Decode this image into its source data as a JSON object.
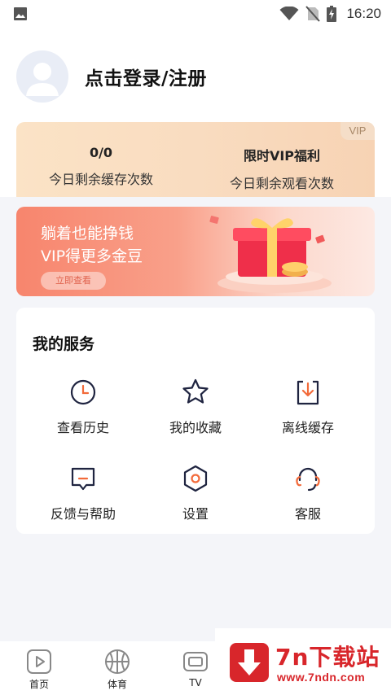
{
  "status_bar": {
    "time": "16:20",
    "icons": [
      "image-icon",
      "wifi-icon",
      "no-sim-icon",
      "battery-charging-icon"
    ]
  },
  "profile": {
    "login_label": "点击登录/注册"
  },
  "vip_card": {
    "tag": "VIP",
    "cache_count": "0/0",
    "cache_label": "今日剩余缓存次数",
    "watch_value": "限时VIP福利",
    "watch_label": "今日剩余观看次数"
  },
  "banner": {
    "title": "躺着也能挣钱",
    "subtitle": "VIP得更多金豆",
    "button": "立即查看"
  },
  "services": {
    "title": "我的服务",
    "items": [
      {
        "label": "查看历史",
        "icon": "clock-icon"
      },
      {
        "label": "我的收藏",
        "icon": "star-icon"
      },
      {
        "label": "离线缓存",
        "icon": "download-icon"
      },
      {
        "label": "反馈与帮助",
        "icon": "feedback-icon"
      },
      {
        "label": "设置",
        "icon": "settings-icon"
      },
      {
        "label": "客服",
        "icon": "headset-icon"
      }
    ]
  },
  "bottom_nav": {
    "items": [
      {
        "label": "首页",
        "icon": "play-icon"
      },
      {
        "label": "体育",
        "icon": "basketball-icon"
      },
      {
        "label": "TV",
        "icon": "tv-icon"
      }
    ]
  },
  "watermark": {
    "name": "7n下载站",
    "url": "www.7ndn.com"
  },
  "colors": {
    "accent": "#f26a3a",
    "icon_dark": "#1f2440",
    "watermark_red": "#d8262b"
  }
}
